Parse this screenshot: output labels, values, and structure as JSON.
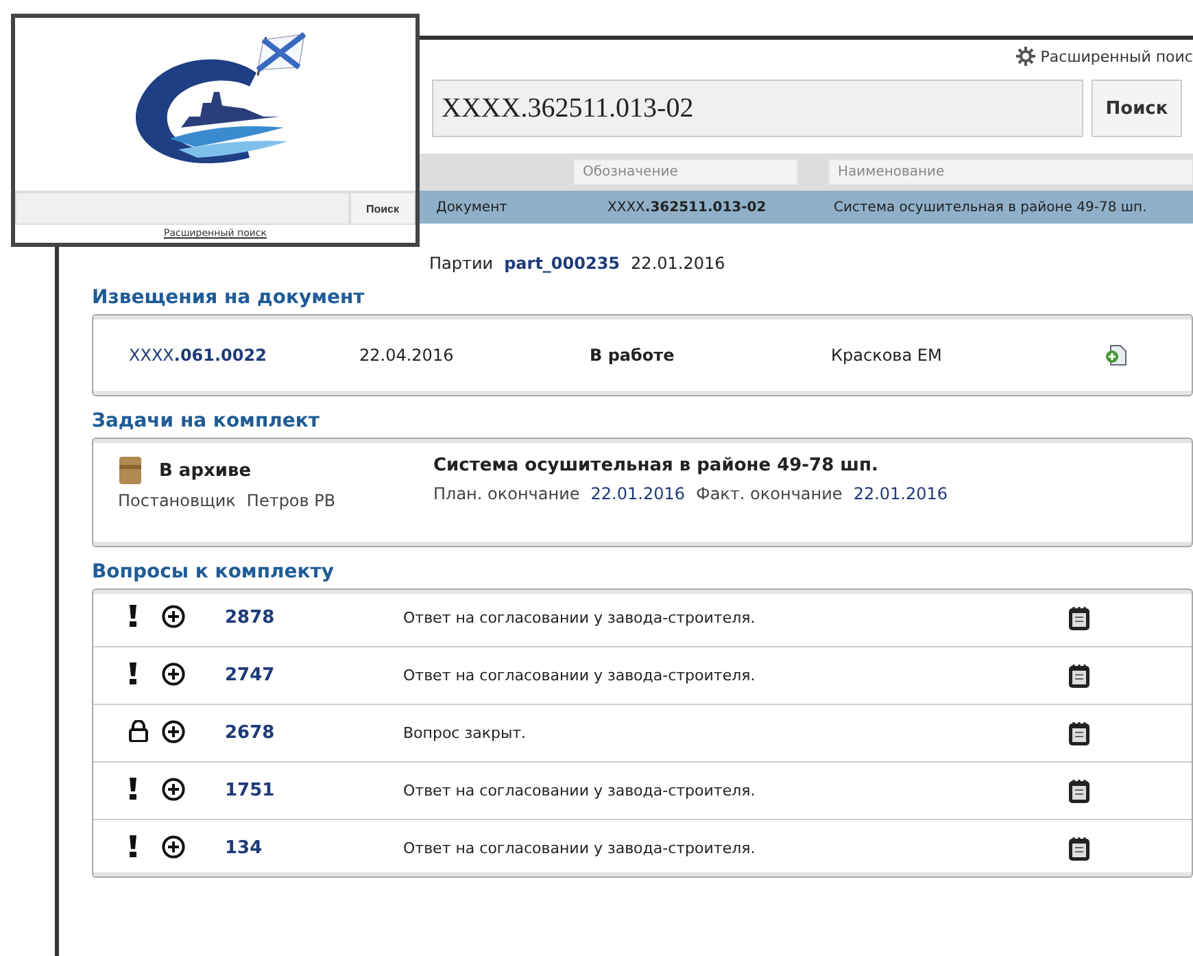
{
  "main": {
    "advanced_search": "Расширенный поис",
    "search": {
      "value": "XXXX.362511.013-02",
      "button": "Поиск"
    },
    "columns": [
      "Обозначение",
      "Наименование"
    ],
    "result": {
      "type": "Документ",
      "designation": "XXXX**.362511.013-02**",
      "name": "Система осушительная в районе 49-78 шп.",
      "selected": true
    },
    "batch": {
      "label": "Партии",
      "id": "part_000235",
      "date": "22.01.2016"
    },
    "notices": {
      "title": "Извещения на документ",
      "items": [
        {
          "number": "XXXX**.061.0022**",
          "date": "22.04.2016",
          "status": "В работе",
          "author": "Краскова ЕМ"
        }
      ]
    },
    "tasks": {
      "title": "Задачи на комплект",
      "items": [
        {
          "status": "В архиве",
          "assigner_label": "Постановщик",
          "assigner": "Петров РВ",
          "name": "Система осушительная в районе 49-78 шп.",
          "plan_label": "План. окончание",
          "plan_date": "22.01.2016",
          "fact_label": "Факт. окончание",
          "fact_date": "22.01.2016"
        }
      ]
    },
    "questions": {
      "title": "Вопросы к комплекту",
      "items": [
        {
          "kind": "open",
          "number": "2878",
          "text": "Ответ на согласовании у завода-строителя."
        },
        {
          "kind": "open",
          "number": "2747",
          "text": "Ответ на согласовании у завода-строителя."
        },
        {
          "kind": "closed",
          "number": "2678",
          "text": "Вопрос закрыт."
        },
        {
          "kind": "open",
          "number": "1751",
          "text": "Ответ на согласовании у завода-строителя."
        },
        {
          "kind": "open",
          "number": "134",
          "text": "Ответ на согласовании у завода-строителя."
        }
      ]
    }
  },
  "inset": {
    "search": {
      "button": "Поиск"
    },
    "advanced_search": "Расширенный поиск"
  }
}
